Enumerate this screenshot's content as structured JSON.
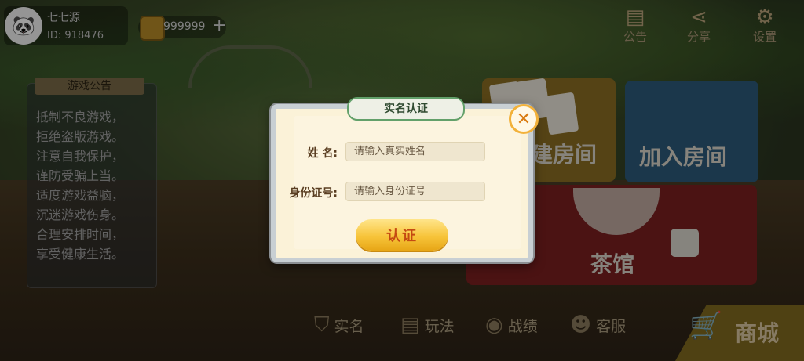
{
  "player": {
    "nickname": "七七源",
    "id_text": "ID: 918476",
    "coins": "999999",
    "add_coins_label": "+"
  },
  "top_menu": [
    {
      "label": "公告",
      "icon": "notice-board-icon"
    },
    {
      "label": "分享",
      "icon": "share-icon"
    },
    {
      "label": "设置",
      "icon": "gear-icon"
    }
  ],
  "announcement": {
    "title": "游戏公告",
    "lines": [
      "抵制不良游戏，",
      "拒绝盗版游戏。",
      "注意自我保护，",
      "谨防受骗上当。",
      "适度游戏益脑，",
      "沉迷游戏伤身。",
      "合理安排时间，",
      "享受健康生活。"
    ]
  },
  "rooms": {
    "create": "建房间",
    "join": "加入房间",
    "tea": "茶馆"
  },
  "bottom_menu": [
    {
      "label": "实名",
      "icon": "shield-check-icon"
    },
    {
      "label": "玩法",
      "icon": "document-icon"
    },
    {
      "label": "战绩",
      "icon": "medal-icon"
    },
    {
      "label": "客服",
      "icon": "support-agent-icon"
    }
  ],
  "shop": {
    "label": "商城",
    "icon": "shopping-cart-icon"
  },
  "modal": {
    "title": "实名认证",
    "name_label": "姓  名:",
    "name_placeholder": "请输入真实姓名",
    "id_label": "身份证号:",
    "id_placeholder": "请输入身份证号",
    "submit_label": "认证",
    "close_icon": "close-icon"
  }
}
